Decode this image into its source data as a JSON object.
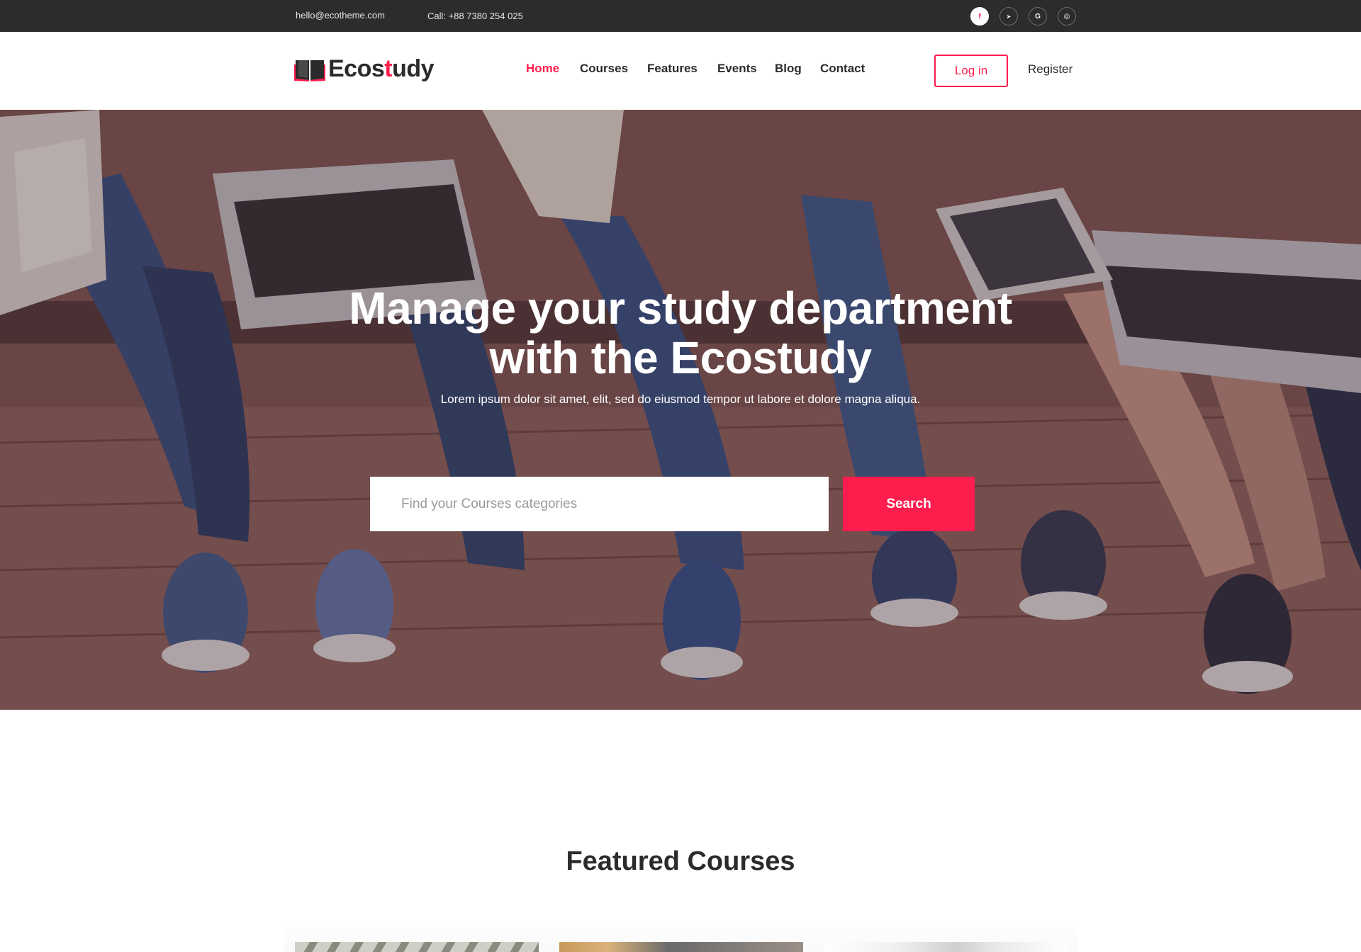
{
  "topbar": {
    "email": "hello@ecotheme.com",
    "phone": "Call: +88 7380 254 025",
    "social": [
      {
        "icon": "facebook-icon",
        "glyph": "f"
      },
      {
        "icon": "twitter-icon",
        "glyph": "➤"
      },
      {
        "icon": "google-icon",
        "glyph": "G"
      },
      {
        "icon": "instagram-icon",
        "glyph": "◎"
      }
    ]
  },
  "header": {
    "logo_main": "Ecos",
    "logo_accent": "t",
    "logo_end": "udy",
    "nav": [
      "Home",
      "Courses",
      "Features",
      "Events",
      "Blog",
      "Contact"
    ],
    "active_nav": "Home",
    "login_label": "Log in",
    "register_label": "Register"
  },
  "hero": {
    "title_line1": "Manage your study department",
    "title_line2": "with the Ecostudy",
    "subtitle": "Lorem ipsum dolor sit amet,  elit, sed do eiusmod tempor  ut labore et dolore magna aliqua.",
    "search_placeholder": "Find your Courses categories",
    "search_label": "Search"
  },
  "featured": {
    "title": "Featured Courses"
  },
  "colors": {
    "accent": "#ff1d4e",
    "topbar_bg": "#2c2c2c",
    "text_dark": "#2b2b2b"
  }
}
